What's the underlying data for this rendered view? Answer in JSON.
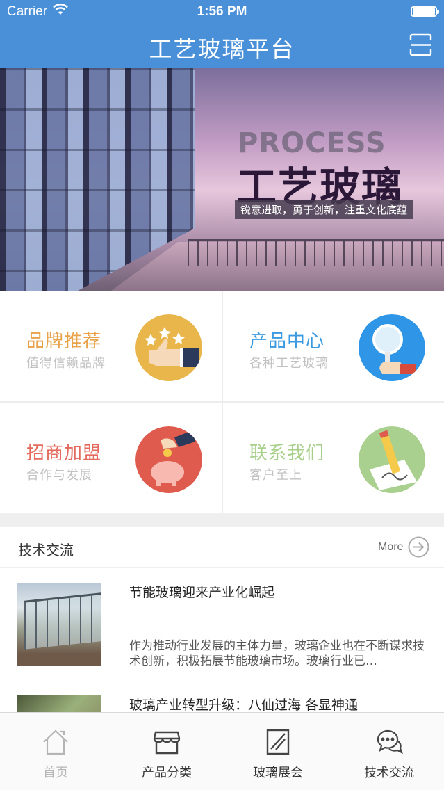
{
  "status_bar": {
    "carrier": "Carrier",
    "time": "1:56 PM"
  },
  "header": {
    "title": "工艺玻璃平台",
    "scan_icon": "scan-icon"
  },
  "banner": {
    "overlay_english": "PROCESS",
    "overlay_title": "工艺玻璃",
    "overlay_subtitle": "锐意进取，勇于创新，注重文化底蕴"
  },
  "features": [
    {
      "title": "品牌推荐",
      "subtitle": "值得信赖品牌",
      "color": "#e8a24a",
      "icon": "thumbs-up-icon"
    },
    {
      "title": "产品中心",
      "subtitle": "各种工艺玻璃",
      "color": "#3c9be0",
      "icon": "magnifier-icon"
    },
    {
      "title": "招商加盟",
      "subtitle": "合作与发展",
      "color": "#e36a5c",
      "icon": "piggy-bank-icon"
    },
    {
      "title": "联系我们",
      "subtitle": "客户至上",
      "color": "#a8cf8a",
      "icon": "pencil-paper-icon"
    }
  ],
  "tech_section": {
    "title": "技术交流",
    "more_label": "More",
    "articles": [
      {
        "title": "节能玻璃迎来产业化崛起",
        "description": "作为推动行业发展的主体力量，玻璃企业也在不断谋求技术创新，积极拓展节能玻璃市场。玻璃行业已…"
      },
      {
        "title": "玻璃产业转型升级：八仙过海 各显神通",
        "description": ""
      }
    ]
  },
  "tabbar": [
    {
      "label": "首页",
      "icon": "home-icon",
      "active": false
    },
    {
      "label": "产品分类",
      "icon": "store-icon",
      "active": true
    },
    {
      "label": "玻璃展会",
      "icon": "glass-panel-icon",
      "active": true
    },
    {
      "label": "技术交流",
      "icon": "chat-icon",
      "active": true
    }
  ],
  "colors": {
    "header_bg": "#4a90d9",
    "tab_inactive": "#b5b5b5",
    "text_dark": "#333333"
  }
}
